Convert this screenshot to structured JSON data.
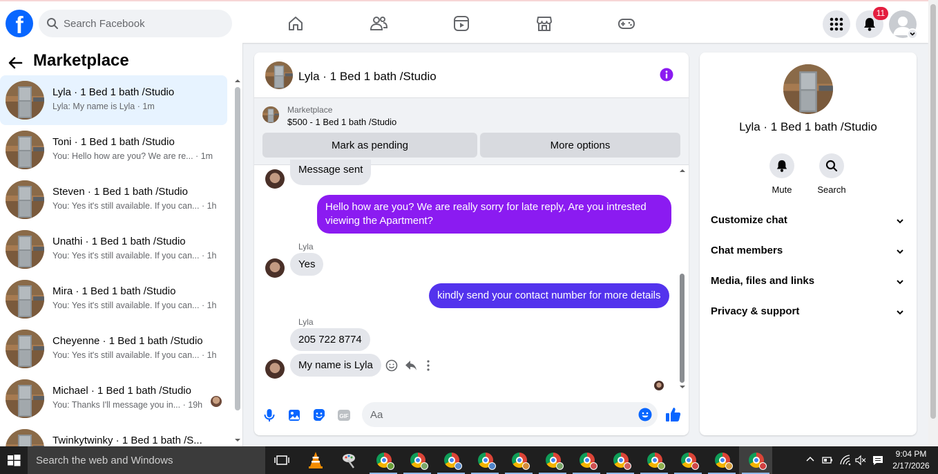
{
  "topbar": {
    "logo_letter": "f",
    "search_placeholder": "Search Facebook",
    "notification_count": "11",
    "nav": [
      "home-icon",
      "friends-icon",
      "video-icon",
      "marketplace-icon",
      "gaming-icon"
    ]
  },
  "sidebar": {
    "title": "Marketplace",
    "conversations": [
      {
        "name": "Lyla · 1 Bed 1 bath /Studio",
        "preview": "Lyla: My name is Lyla · 1m"
      },
      {
        "name": "Toni · 1 Bed 1 bath /Studio",
        "preview": "You: Hello how are you? We are re... · 1m"
      },
      {
        "name": "Steven · 1 Bed 1 bath /Studio",
        "preview": "You: Yes it's still available. If you can... · 1h"
      },
      {
        "name": "Unathi · 1 Bed 1 bath /Studio",
        "preview": "You: Yes it's still available. If you can... · 1h"
      },
      {
        "name": "Mira · 1 Bed 1 bath /Studio",
        "preview": "You: Yes it's still available. If you can... · 1h"
      },
      {
        "name": "Cheyenne · 1 Bed 1 bath /Studio",
        "preview": "You: Yes it's still available. If you can... · 1h"
      },
      {
        "name": "Michael · 1 Bed 1 bath /Studio",
        "preview": "You: Thanks I'll message you in... · 19h"
      },
      {
        "name": "Twinkytwinky · 1 Bed 1 bath /S...",
        "preview": ""
      }
    ]
  },
  "chat": {
    "title": "Lyla · 1 Bed 1 bath /Studio",
    "listing_source": "Marketplace",
    "listing_price": "$500 - 1 Bed 1 bath /Studio",
    "mark_pending_label": "Mark as pending",
    "more_options_label": "More options",
    "messages": {
      "m1": "Message sent",
      "m2": "Hello how are you? We are really sorry for late reply,  Are you intrested viewing the Apartment?",
      "sender": "Lyla",
      "m3": "Yes",
      "m4": "kindly send your contact number for more details",
      "m5": "205 722 8774",
      "m6": "My name is Lyla"
    },
    "composer_placeholder": "Aa",
    "colors": {
      "outgoing_purple": "#8b1bf1",
      "outgoing_indigo": "#5333ed",
      "accent": "#0866ff"
    }
  },
  "details": {
    "title": "Lyla · 1 Bed 1 bath /Studio",
    "actions": [
      "Mute",
      "Search"
    ],
    "sections": [
      "Customize chat",
      "Chat members",
      "Media, files and links",
      "Privacy & support"
    ]
  },
  "taskbar": {
    "search_placeholder": "Search the web and Windows",
    "time": "9:04 PM",
    "date": "2/17/2026"
  }
}
